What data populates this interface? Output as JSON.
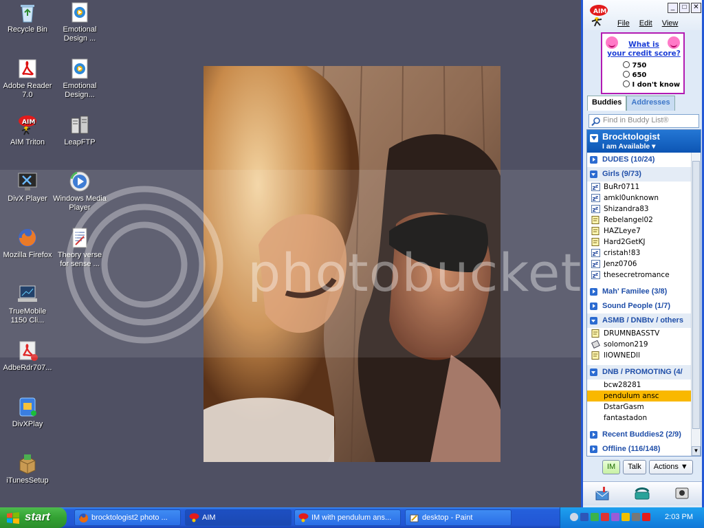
{
  "desktop": {
    "icons": [
      {
        "name": "recycle-bin",
        "label": "Recycle Bin"
      },
      {
        "name": "emotional-design-1",
        "label": "Emotional\nDesign ..."
      },
      {
        "name": "adobe-reader",
        "label": "Adobe Reader\n7.0"
      },
      {
        "name": "emotional-design-2",
        "label": "Emotional\nDesign..."
      },
      {
        "name": "aim-triton",
        "label": "AIM Triton"
      },
      {
        "name": "leapftp",
        "label": "LeapFTP"
      },
      {
        "name": "divx-player",
        "label": "DivX Player"
      },
      {
        "name": "windows-media-player",
        "label": "Windows Media\nPlayer"
      },
      {
        "name": "mozilla-firefox",
        "label": "Mozilla Firefox"
      },
      {
        "name": "theory-verse",
        "label": "Theory verse\nfor sense ..."
      },
      {
        "name": "truemobile",
        "label": "TrueMobile\n1150 Cli..."
      },
      {
        "name": "adberdr707",
        "label": "AdbeRdr707..."
      },
      {
        "name": "divxplay",
        "label": "DivXPlay"
      },
      {
        "name": "itunessetup",
        "label": "iTunesSetup"
      }
    ],
    "watermark": "photobucket"
  },
  "aim": {
    "logo": "AIM",
    "menu": [
      "File",
      "Edit",
      "View"
    ],
    "ad": {
      "link": "What is\nyour credit score?",
      "options": [
        "750",
        "650",
        "I don't know"
      ]
    },
    "tabs": {
      "buddies": "Buddies",
      "addresses": "Addresses"
    },
    "search_placeholder": "Find in Buddy List®",
    "me": {
      "screen_name": "Brocktologist",
      "status": "I am Available"
    },
    "groups": [
      {
        "label": "DUDES (10/24)",
        "expanded": false,
        "buddies": []
      },
      {
        "label": "Girls (9/73)",
        "expanded": true,
        "buddies": [
          "BuRr0711",
          "amkl0unknown",
          "Shizandra83",
          "Rebelangel02",
          "HAZLeye7",
          "Hard2GetKJ",
          "cristah!83",
          "Jenz0706",
          "thesecretromance"
        ]
      },
      {
        "label": "Mah' Familee (3/8)",
        "expanded": false,
        "buddies": []
      },
      {
        "label": "Sound People (1/7)",
        "expanded": false,
        "buddies": []
      },
      {
        "label": "ASMB / DNBtv / others",
        "expanded": true,
        "buddies": [
          "DRUMNBASSTV",
          "solomon219",
          "llOWNEDll"
        ]
      },
      {
        "label": "DNB / PROMOTING (4/",
        "expanded": true,
        "buddies": [
          "bcw28281",
          "pendulum ansc",
          "DstarGasm",
          "fantastadon"
        ]
      },
      {
        "label": "Recent Buddies2 (2/9)",
        "expanded": false,
        "buddies": []
      },
      {
        "label": "Offline (116/148)",
        "expanded": false,
        "buddies": []
      }
    ],
    "selected_buddy": "pendulum ansc",
    "buttons": {
      "im": "IM",
      "talk": "Talk",
      "actions": "Actions"
    }
  },
  "taskbar": {
    "start": "start",
    "tasks": [
      {
        "label": "brocktologist2 photo ...",
        "active": false
      },
      {
        "label": "AIM",
        "active": true
      },
      {
        "label": "IM with pendulum ans...",
        "active": false
      },
      {
        "label": "desktop - Paint",
        "active": false
      }
    ],
    "clock": "2:03 PM"
  }
}
